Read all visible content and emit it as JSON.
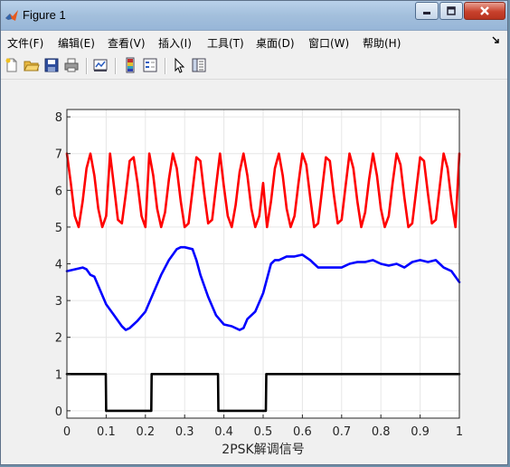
{
  "window": {
    "title": "Figure 1"
  },
  "menu": {
    "items": [
      "文件(F)",
      "编辑(E)",
      "查看(V)",
      "插入(I)",
      "工具(T)",
      "桌面(D)",
      "窗口(W)",
      "帮助(H)"
    ]
  },
  "toolbar": {
    "icons": [
      "new-figure-icon",
      "open-file-icon",
      "save-icon",
      "print-icon",
      "link-plot-icon",
      "insert-colorbar-icon",
      "insert-legend-icon",
      "edit-plot-icon",
      "property-inspector-icon"
    ]
  },
  "colors": {
    "carrier": "#ff0000",
    "demod": "#0000ff",
    "digital": "#000000"
  },
  "chart_data": {
    "type": "line",
    "title": "",
    "xlabel": "2PSK解调信号",
    "ylabel": "",
    "xlim": [
      0,
      1
    ],
    "ylim": [
      -0.2,
      8.2
    ],
    "xticks": [
      "0",
      "0.1",
      "0.2",
      "0.3",
      "0.4",
      "0.5",
      "0.6",
      "0.7",
      "0.8",
      "0.9",
      "1"
    ],
    "yticks": [
      "0",
      "1",
      "2",
      "3",
      "4",
      "5",
      "6",
      "7",
      "8"
    ],
    "grid": true,
    "series": [
      {
        "role": "carrier",
        "color": "#ff0000",
        "x": [
          0,
          0.01,
          0.02,
          0.03,
          0.04,
          0.05,
          0.06,
          0.07,
          0.08,
          0.09,
          0.1,
          0.11,
          0.12,
          0.13,
          0.14,
          0.15,
          0.16,
          0.17,
          0.18,
          0.19,
          0.2,
          0.21,
          0.22,
          0.23,
          0.24,
          0.25,
          0.26,
          0.27,
          0.28,
          0.29,
          0.3,
          0.31,
          0.32,
          0.33,
          0.34,
          0.35,
          0.36,
          0.37,
          0.38,
          0.39,
          0.4,
          0.41,
          0.42,
          0.43,
          0.44,
          0.45,
          0.46,
          0.47,
          0.48,
          0.49,
          0.5,
          0.51,
          0.52,
          0.53,
          0.54,
          0.55,
          0.56,
          0.57,
          0.58,
          0.59,
          0.6,
          0.61,
          0.62,
          0.63,
          0.64,
          0.65,
          0.66,
          0.67,
          0.68,
          0.69,
          0.7,
          0.71,
          0.72,
          0.73,
          0.74,
          0.75,
          0.76,
          0.77,
          0.78,
          0.79,
          0.8,
          0.81,
          0.82,
          0.83,
          0.84,
          0.85,
          0.86,
          0.87,
          0.88,
          0.89,
          0.9,
          0.91,
          0.92,
          0.93,
          0.94,
          0.95,
          0.96,
          0.97,
          0.98,
          0.99,
          1
        ],
        "y": [
          7.0,
          6.2,
          5.3,
          5.0,
          5.7,
          6.6,
          7.0,
          6.4,
          5.5,
          5.0,
          5.3,
          7.0,
          6.1,
          5.2,
          5.1,
          5.9,
          6.8,
          6.9,
          6.2,
          5.3,
          5.0,
          7.0,
          6.4,
          5.5,
          5.0,
          5.4,
          6.3,
          7.0,
          6.6,
          5.7,
          5.0,
          5.1,
          6.0,
          6.9,
          6.8,
          5.9,
          5.1,
          5.2,
          6.1,
          7.0,
          6.1,
          5.3,
          5.0,
          5.6,
          6.5,
          7.0,
          6.4,
          5.5,
          5.0,
          5.3,
          6.2,
          5.0,
          5.7,
          6.6,
          7.0,
          6.4,
          5.5,
          5.0,
          5.3,
          6.2,
          7.0,
          6.7,
          5.8,
          5.0,
          5.1,
          6.0,
          6.9,
          6.8,
          5.9,
          5.1,
          5.2,
          6.1,
          7.0,
          6.6,
          5.7,
          5.0,
          5.4,
          6.3,
          7.0,
          6.4,
          5.5,
          5.0,
          5.3,
          6.2,
          7.0,
          6.7,
          5.8,
          5.0,
          5.1,
          6.0,
          6.9,
          6.8,
          5.9,
          5.1,
          5.2,
          6.1,
          7.0,
          6.6,
          5.7,
          5.0,
          7.0
        ]
      },
      {
        "role": "demodulated",
        "color": "#0000ff",
        "x": [
          0,
          0.02,
          0.04,
          0.05,
          0.06,
          0.07,
          0.08,
          0.1,
          0.12,
          0.14,
          0.15,
          0.16,
          0.18,
          0.2,
          0.22,
          0.24,
          0.26,
          0.28,
          0.29,
          0.3,
          0.32,
          0.33,
          0.34,
          0.36,
          0.38,
          0.4,
          0.42,
          0.44,
          0.45,
          0.46,
          0.48,
          0.5,
          0.52,
          0.53,
          0.54,
          0.56,
          0.58,
          0.6,
          0.62,
          0.63,
          0.64,
          0.66,
          0.68,
          0.7,
          0.72,
          0.74,
          0.76,
          0.78,
          0.8,
          0.82,
          0.84,
          0.86,
          0.88,
          0.9,
          0.92,
          0.94,
          0.95,
          0.96,
          0.98,
          1
        ],
        "y": [
          3.8,
          3.85,
          3.9,
          3.85,
          3.7,
          3.65,
          3.4,
          2.9,
          2.6,
          2.3,
          2.2,
          2.25,
          2.45,
          2.7,
          3.2,
          3.7,
          4.1,
          4.4,
          4.45,
          4.45,
          4.4,
          4.1,
          3.7,
          3.1,
          2.6,
          2.35,
          2.3,
          2.2,
          2.25,
          2.5,
          2.7,
          3.2,
          4.0,
          4.1,
          4.1,
          4.2,
          4.2,
          4.25,
          4.1,
          4.0,
          3.9,
          3.9,
          3.9,
          3.9,
          4.0,
          4.05,
          4.05,
          4.1,
          4.0,
          3.95,
          4.0,
          3.9,
          4.05,
          4.1,
          4.05,
          4.1,
          4.0,
          3.9,
          3.8,
          3.5
        ]
      },
      {
        "role": "digital",
        "color": "#000000",
        "x": [
          0,
          0.099,
          0.1,
          0.215,
          0.216,
          0.385,
          0.386,
          0.507,
          0.508,
          1
        ],
        "y": [
          1,
          1,
          0,
          0,
          1,
          1,
          0,
          0,
          1,
          1
        ]
      }
    ]
  }
}
